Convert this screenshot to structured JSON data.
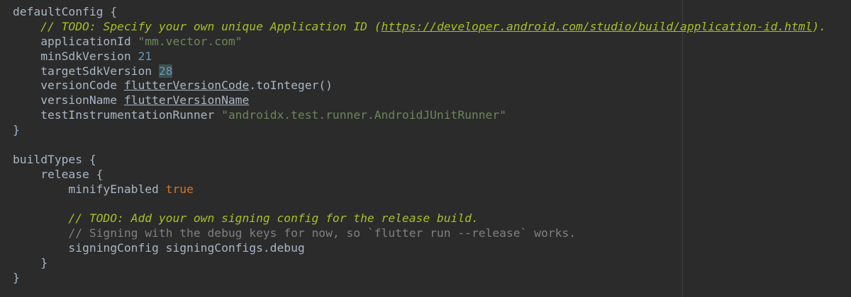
{
  "editor": {
    "lines": [
      {
        "segments": [
          {
            "text": "defaultConfig {",
            "style": "plain"
          }
        ]
      },
      {
        "segments": [
          {
            "text": "    ",
            "style": "plain"
          },
          {
            "text": "// TODO: Specify your own unique Application ID (",
            "style": "todo"
          },
          {
            "text": "https://developer.android.com/studio/build/application-id.html",
            "style": "link"
          },
          {
            "text": ").",
            "style": "todo"
          }
        ]
      },
      {
        "segments": [
          {
            "text": "    applicationId ",
            "style": "plain"
          },
          {
            "text": "\"mm.vector.com\"",
            "style": "str"
          }
        ]
      },
      {
        "segments": [
          {
            "text": "    minSdkVersion ",
            "style": "plain"
          },
          {
            "text": "21",
            "style": "num"
          }
        ]
      },
      {
        "segments": [
          {
            "text": "    targetSdkVersion ",
            "style": "plain"
          },
          {
            "text": "28",
            "style": "num-hl"
          }
        ]
      },
      {
        "segments": [
          {
            "text": "    versionCode ",
            "style": "plain"
          },
          {
            "text": "flutterVersionCode",
            "style": "ref"
          },
          {
            "text": ".toInteger()",
            "style": "plain"
          }
        ]
      },
      {
        "segments": [
          {
            "text": "    versionName ",
            "style": "plain"
          },
          {
            "text": "flutterVersionName",
            "style": "ref"
          }
        ]
      },
      {
        "segments": [
          {
            "text": "    testInstrumentationRunner ",
            "style": "plain"
          },
          {
            "text": "\"androidx.test.runner.AndroidJUnitRunner\"",
            "style": "str"
          }
        ]
      },
      {
        "segments": [
          {
            "text": "}",
            "style": "plain"
          }
        ]
      },
      {
        "segments": [
          {
            "text": "",
            "style": "plain"
          }
        ]
      },
      {
        "segments": [
          {
            "text": "buildTypes {",
            "style": "plain"
          }
        ]
      },
      {
        "segments": [
          {
            "text": "    release {",
            "style": "plain"
          }
        ]
      },
      {
        "segments": [
          {
            "text": "        minifyEnabled ",
            "style": "plain"
          },
          {
            "text": "true",
            "style": "kw"
          }
        ]
      },
      {
        "segments": [
          {
            "text": "",
            "style": "plain"
          }
        ]
      },
      {
        "segments": [
          {
            "text": "        ",
            "style": "plain"
          },
          {
            "text": "// TODO: Add your own signing config for the release build.",
            "style": "todo"
          }
        ]
      },
      {
        "segments": [
          {
            "text": "        ",
            "style": "plain"
          },
          {
            "text": "// Signing with the debug keys for now, so `flutter run --release` works.",
            "style": "comment"
          }
        ]
      },
      {
        "segments": [
          {
            "text": "        signingConfig signingConfigs.debug",
            "style": "plain"
          }
        ]
      },
      {
        "segments": [
          {
            "text": "    }",
            "style": "plain"
          }
        ]
      },
      {
        "segments": [
          {
            "text": "}",
            "style": "plain"
          }
        ]
      }
    ]
  }
}
